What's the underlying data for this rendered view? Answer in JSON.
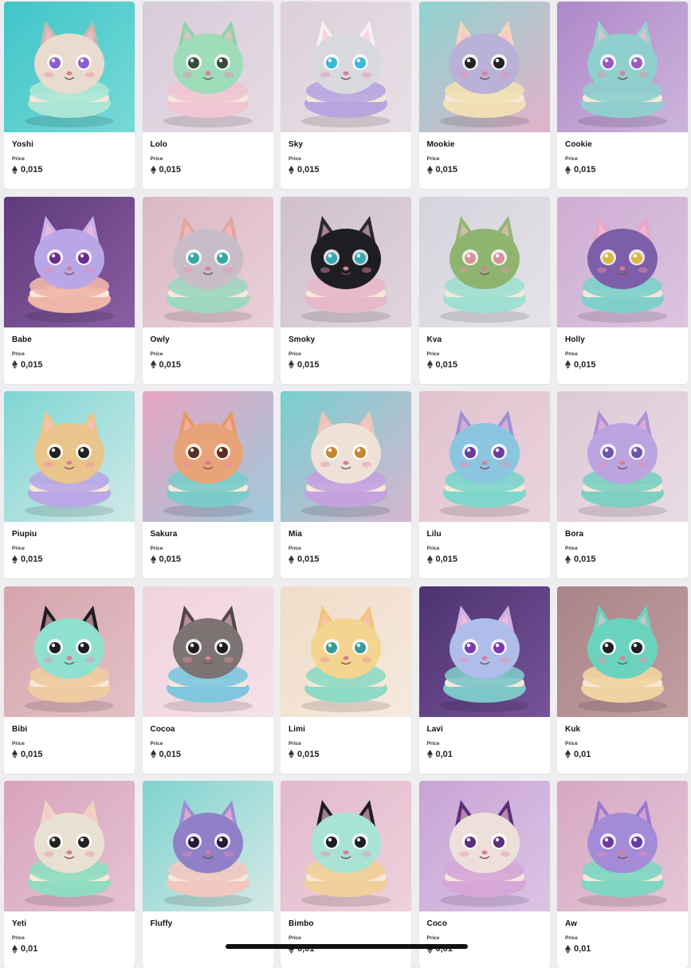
{
  "price_label": "Price",
  "currency_icon": "ethereum-icon",
  "items": [
    {
      "name": "Yoshi",
      "price": "0,015",
      "bg": [
        "#3fc5c9",
        "#78d9d7"
      ],
      "body": "#e9dccf",
      "ear": "#c8b7ad",
      "eye": "#8c5fd0",
      "macaron": "#a9e6d6"
    },
    {
      "name": "Lolo",
      "price": "0,015",
      "bg": [
        "#d7cbd8",
        "#e5dbe4"
      ],
      "body": "#9fdcb9",
      "ear": "#8fd1a8",
      "eye": "#3a4a3a",
      "macaron": "#f0c6d2"
    },
    {
      "name": "Sky",
      "price": "0,015",
      "bg": [
        "#ddd0d8",
        "#e8e0e6"
      ],
      "body": "#d8d8df",
      "ear": "#f5f3f4",
      "eye": "#3ab9d8",
      "macaron": "#b8a5e0"
    },
    {
      "name": "Mookie",
      "price": "0,015",
      "bg": [
        "#8fd3cf",
        "#e3b2c9"
      ],
      "body": "#b9b1d8",
      "ear": "#f1d7b9",
      "eye": "#222222",
      "macaron": "#f0dfb5"
    },
    {
      "name": "Cookie",
      "price": "0,015",
      "bg": [
        "#ae87c9",
        "#cdb5dc"
      ],
      "body": "#8fcfcd",
      "ear": "#96d2ce",
      "eye": "#9a5bc0",
      "macaron": "#8fcfcd"
    },
    {
      "name": "Babe",
      "price": "0,015",
      "bg": [
        "#5e3a7b",
        "#8a5ea3"
      ],
      "body": "#b9a6e6",
      "ear": "#c7b1ea",
      "eye": "#6c2a8a",
      "macaron": "#efb5a9"
    },
    {
      "name": "Owly",
      "price": "0,015",
      "bg": [
        "#dcb7c5",
        "#e9cfd8"
      ],
      "body": "#c7bcc7",
      "ear": "#e0a99a",
      "eye": "#36a8a5",
      "macaron": "#9fd6c0"
    },
    {
      "name": "Smoky",
      "price": "0,015",
      "bg": [
        "#cfc0cc",
        "#e1d4dc"
      ],
      "body": "#1e1e22",
      "ear": "#2a2a2e",
      "eye": "#36a8b5",
      "macaron": "#e6b9c9"
    },
    {
      "name": "Kva",
      "price": "0,015",
      "bg": [
        "#d5d3dc",
        "#e6e2e9"
      ],
      "body": "#8db56f",
      "ear": "#91b774",
      "eye": "#d7919a",
      "macaron": "#9fe0d3"
    },
    {
      "name": "Holly",
      "price": "0,015",
      "bg": [
        "#cdaed2",
        "#dcc4df"
      ],
      "body": "#7d5ea8",
      "ear": "#e5a9c8",
      "eye": "#d7b83a",
      "macaron": "#7fd0cb"
    },
    {
      "name": "Piupiu",
      "price": "0,015",
      "bg": [
        "#7fd6d2",
        "#cfe9e8"
      ],
      "body": "#e9c58b",
      "ear": "#e9c58b",
      "eye": "#222222",
      "macaron": "#b9a8e5"
    },
    {
      "name": "Sakura",
      "price": "0,015",
      "bg": [
        "#e7a3c1",
        "#9fc9da"
      ],
      "body": "#e8a478",
      "ear": "#e6995e",
      "eye": "#5a2f20",
      "macaron": "#7ccbc9"
    },
    {
      "name": "Mia",
      "price": "0,015",
      "bg": [
        "#77cfcf",
        "#d6b6cf"
      ],
      "body": "#eee2d8",
      "ear": "#e7c7b5",
      "eye": "#c8872e",
      "macaron": "#c3a2de"
    },
    {
      "name": "Lilu",
      "price": "0,015",
      "bg": [
        "#e0c2cf",
        "#ead3dc"
      ],
      "body": "#8cc5df",
      "ear": "#9d8fd7",
      "eye": "#6b3a9a",
      "macaron": "#7ed6cc"
    },
    {
      "name": "Bora",
      "price": "0,015",
      "bg": [
        "#ddc9d6",
        "#e8dbe3"
      ],
      "body": "#bba4e0",
      "ear": "#ab92d7",
      "eye": "#6e55a8",
      "macaron": "#7fcfc2"
    },
    {
      "name": "Bibi",
      "price": "0,015",
      "bg": [
        "#d5a4ad",
        "#e3c0c5"
      ],
      "body": "#8fe0cf",
      "ear": "#1e1e22",
      "eye": "#1e1e22",
      "macaron": "#f0caa0"
    },
    {
      "name": "Cocoa",
      "price": "0,015",
      "bg": [
        "#efd3de",
        "#f5e1e8"
      ],
      "body": "#7c7373",
      "ear": "#514848",
      "eye": "#1e1e22",
      "macaron": "#7fc7df"
    },
    {
      "name": "Limi",
      "price": "0,015",
      "bg": [
        "#f0dcc8",
        "#f6e9dd"
      ],
      "body": "#f3d58f",
      "ear": "#f0c77a",
      "eye": "#3a9a9a",
      "macaron": "#8fdac4"
    },
    {
      "name": "Lavi",
      "price": "0,01",
      "bg": [
        "#4d3370",
        "#76539a"
      ],
      "body": "#aebde9",
      "ear": "#d0b0e6",
      "eye": "#7a3ab0",
      "macaron": "#7fc6c9"
    },
    {
      "name": "Kuk",
      "price": "0,01",
      "bg": [
        "#a88489",
        "#c29ea2"
      ],
      "body": "#6ad3bd",
      "ear": "#6ad3bd",
      "eye": "#1e1e22",
      "macaron": "#f0d3a0"
    },
    {
      "name": "Yeti",
      "price": "0,01",
      "bg": [
        "#d8a3bc",
        "#e6c2d2"
      ],
      "body": "#e8e0d2",
      "ear": "#ecd4c0",
      "eye": "#222222",
      "macaron": "#8fdcc0"
    },
    {
      "name": "Fluffy",
      "price": "",
      "bg": [
        "#7fd3cf",
        "#d5e9e6"
      ],
      "body": "#8f80c7",
      "ear": "#9e8fd0",
      "eye": "#2a1a3a",
      "macaron": "#f0c8c0"
    },
    {
      "name": "Bimbo",
      "price": "0,01",
      "bg": [
        "#e3b8cb",
        "#edd1dc"
      ],
      "body": "#a8e3d4",
      "ear": "#1e1e22",
      "eye": "#1e1e22",
      "macaron": "#f0cf9a"
    },
    {
      "name": "Coco",
      "price": "0,01",
      "bg": [
        "#c7a4d6",
        "#dcc4e4"
      ],
      "body": "#ede0da",
      "ear": "#5b2f7a",
      "eye": "#5b2f7a",
      "macaron": "#d6a7d8"
    },
    {
      "name": "Aw",
      "price": "0,01",
      "bg": [
        "#d6a8c2",
        "#e6c5d6"
      ],
      "body": "#a48bd8",
      "ear": "#9878d0",
      "eye": "#6a3aa0",
      "macaron": "#7fd6c3"
    }
  ]
}
